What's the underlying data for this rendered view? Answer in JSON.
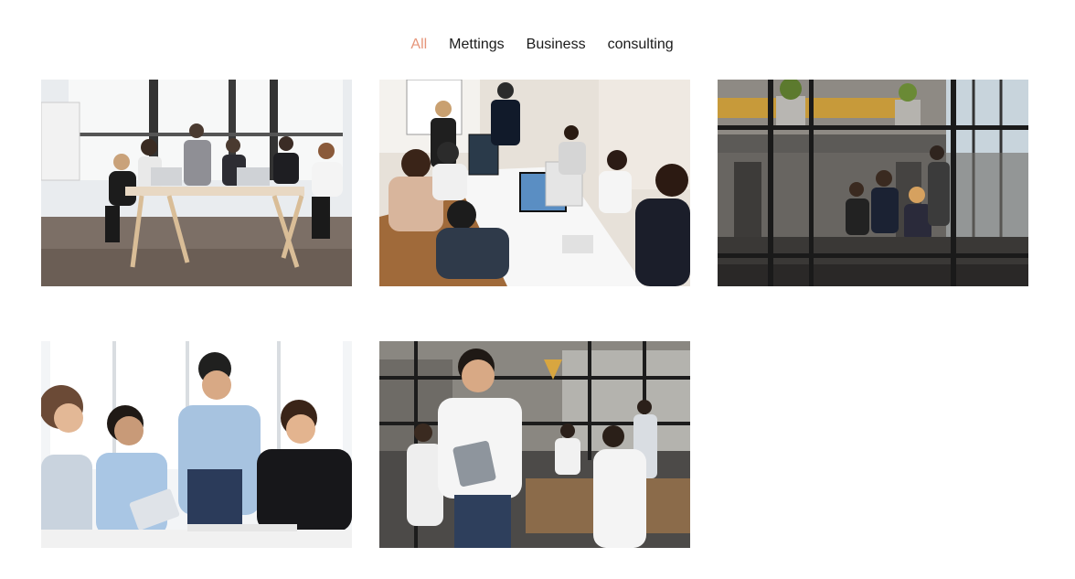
{
  "filters": [
    {
      "label": "All",
      "active": true
    },
    {
      "label": "Mettings",
      "active": false
    },
    {
      "label": "Business",
      "active": false
    },
    {
      "label": "consulting",
      "active": false
    }
  ],
  "gallery": {
    "items": [
      {
        "subject": "team meeting around white table with laptops"
      },
      {
        "subject": "overhead view of team working at desks with monitors"
      },
      {
        "subject": "open office seen through metal shelving"
      },
      {
        "subject": "four colleagues reviewing documents at a table"
      },
      {
        "subject": "smiling man holding laptop in office"
      }
    ]
  },
  "colors": {
    "accent": "#e6957a",
    "text": "#1b1b1b",
    "background": "#ffffff"
  }
}
